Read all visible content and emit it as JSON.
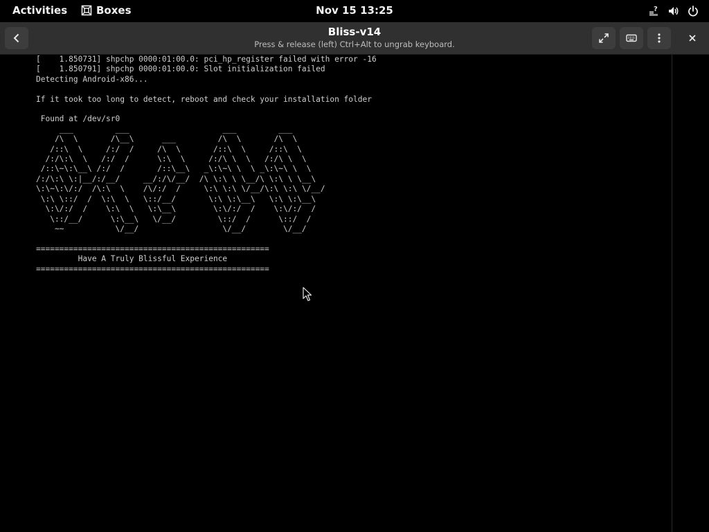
{
  "topbar": {
    "activities": "Activities",
    "app_name": "Boxes",
    "clock": "Nov 15  13:25",
    "tray_icons": [
      "network-unknown-icon",
      "volume-icon",
      "power-icon"
    ]
  },
  "header": {
    "title": "Bliss-v14",
    "subtitle": "Press & release (left) Ctrl+Alt to ungrab keyboard.",
    "buttons": [
      "back-button",
      "fullscreen-button",
      "keyboard-button",
      "menu-button",
      "close-button"
    ]
  },
  "console": {
    "lines": [
      "[    1.850731] shpchp 0000:01:00.0: pci_hp_register failed with error -16",
      "[    1.850791] shpchp 0000:01:00.0: Slot initialization failed",
      "Detecting Android-x86...",
      "",
      "If it took too long to detect, reboot and check your installation folder",
      "",
      " Found at /dev/sr0",
      "     ___         ___                    ___         ___",
      "    /\\  \\       /\\__\\      ___         /\\  \\       /\\  \\",
      "   /::\\  \\     /:/  /     /\\  \\       /::\\  \\     /::\\  \\",
      "  /:/\\:\\  \\   /:/  /      \\:\\  \\     /:/\\ \\  \\   /:/\\ \\  \\",
      " /::\\~\\:\\__\\ /:/  /       /::\\__\\   _\\:\\~\\ \\  \\ _\\:\\~\\ \\  \\",
      "/:/\\:\\ \\:|__/:/__/     __/:/\\/__/  /\\ \\:\\ \\ \\__/\\ \\:\\ \\ \\__\\",
      "\\:\\~\\:\\/:/  /\\:\\  \\    /\\/:/  /     \\:\\ \\:\\ \\/__/\\:\\ \\:\\ \\/__/",
      " \\:\\ \\::/  /  \\:\\  \\   \\::/__/       \\:\\ \\:\\__\\   \\:\\ \\:\\__\\",
      "  \\:\\/:/  /    \\:\\  \\   \\:\\__\\        \\:\\/:/  /    \\:\\/:/  /",
      "   \\::/__/      \\:\\__\\   \\/__/         \\::/  /      \\::/  /",
      "    ~~           \\/__/                  \\/__/        \\/__/",
      "",
      "==================================================",
      "         Have A Truly Blissful Experience",
      "=================================================="
    ]
  }
}
